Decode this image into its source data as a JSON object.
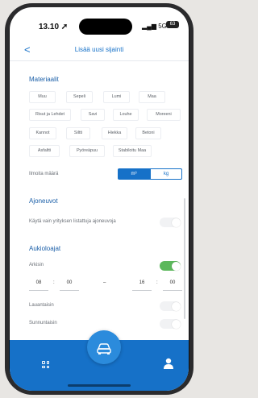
{
  "status": {
    "time": "13.10",
    "network": "5G",
    "battery": "63"
  },
  "navbar": {
    "back_label": "<",
    "title": "Lisää uusi sijainti"
  },
  "materials": {
    "title": "Materiaalit",
    "chips": [
      "Muu",
      "Sepeli",
      "Lumi",
      "Maa",
      "Risut ja Lehdet",
      "Savi",
      "Louhe",
      "Moreeni",
      "Kannot",
      "Siltti",
      "Hiekka",
      "Betoni",
      "Asfaltti",
      "Pyöreäpuu",
      "Stabiloitu Maa"
    ]
  },
  "quantity": {
    "label": "Ilmoita määrä",
    "options": [
      "m³",
      "kg"
    ],
    "selected": "m³"
  },
  "vehicles": {
    "title": "Ajoneuvot",
    "label": "Käytä vain yrityksen listattuja ajoneuvoja",
    "enabled": false
  },
  "hours": {
    "title": "Aukioloajat",
    "weekdays_label": "Arkisin",
    "weekdays_enabled": true,
    "open_hour": "08",
    "open_minute": "00",
    "close_hour": "16",
    "close_minute": "00",
    "range_separator": "–",
    "time_separator": ":",
    "saturday_label": "Lauantaisin",
    "saturday_enabled": false,
    "sunday_label": "Sunnuntaisin",
    "sunday_enabled": false
  },
  "colors": {
    "accent": "#1671c8",
    "toggle_on": "#5cb85c"
  }
}
